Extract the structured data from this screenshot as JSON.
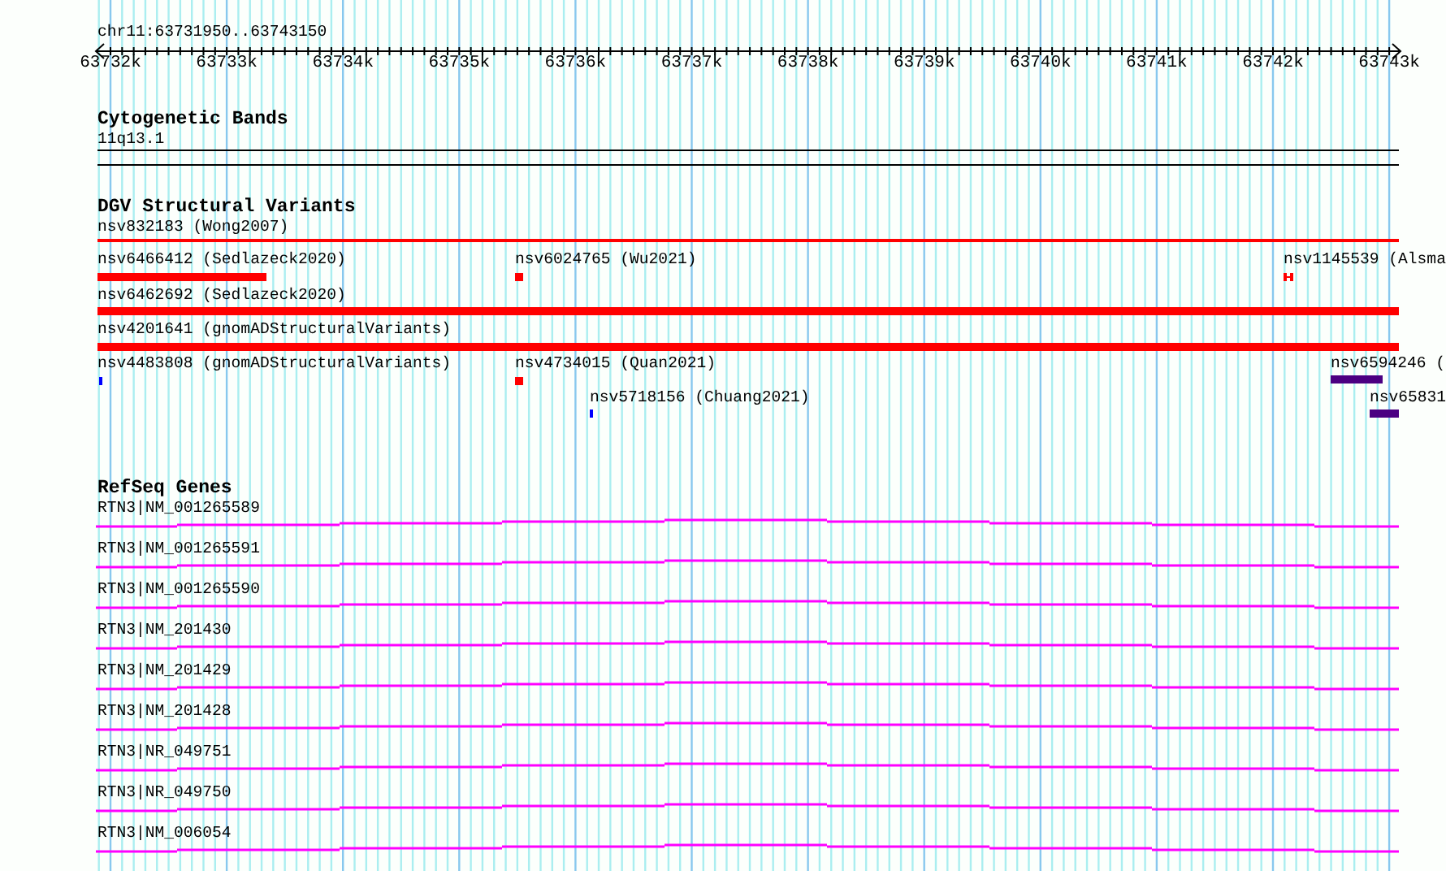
{
  "location": "chr11:63731950..63743150",
  "ruler": {
    "ticks": [
      "63732k",
      "63733k",
      "63734k",
      "63735k",
      "63736k",
      "63737k",
      "63738k",
      "63739k",
      "63740k",
      "63741k",
      "63742k",
      "63743k"
    ]
  },
  "tracks": [
    {
      "kind": "cytoband",
      "title": "Cytogenetic Bands",
      "features": [
        {
          "label": "11q13.1"
        }
      ]
    },
    {
      "kind": "variants",
      "title": "DGV Structural Variants",
      "features": [
        {
          "label": "nsv832183 (Wong2007)",
          "color": "#ff0000"
        },
        {
          "label": "nsv6466412 (Sedlazeck2020)",
          "color": "#ff0000"
        },
        {
          "label": "nsv6024765 (Wu2021)",
          "color": "#ff0000"
        },
        {
          "label": "nsv1145539 (Alsma",
          "color": "#ff0000"
        },
        {
          "label": "nsv6462692 (Sedlazeck2020)",
          "color": "#ff0000"
        },
        {
          "label": "nsv4201641 (gnomADStructuralVariants)",
          "color": "#ff0000"
        },
        {
          "label": "nsv4483808 (gnomADStructuralVariants)",
          "color": "#0000ff"
        },
        {
          "label": "nsv4734015 (Quan2021)",
          "color": "#ff0000"
        },
        {
          "label": "nsv6594246 (",
          "color": "#4b0082"
        },
        {
          "label": "nsv5718156 (Chuang2021)",
          "color": "#0000ff"
        },
        {
          "label": "nsv65831",
          "color": "#4b0082"
        }
      ]
    },
    {
      "kind": "genes",
      "title": "RefSeq Genes",
      "features": [
        {
          "label": "RTN3|NM_001265589"
        },
        {
          "label": "RTN3|NM_001265591"
        },
        {
          "label": "RTN3|NM_001265590"
        },
        {
          "label": "RTN3|NM_201430"
        },
        {
          "label": "RTN3|NM_201429"
        },
        {
          "label": "RTN3|NM_201428"
        },
        {
          "label": "RTN3|NR_049751"
        },
        {
          "label": "RTN3|NR_049750"
        },
        {
          "label": "RTN3|NM_006054"
        }
      ]
    }
  ]
}
